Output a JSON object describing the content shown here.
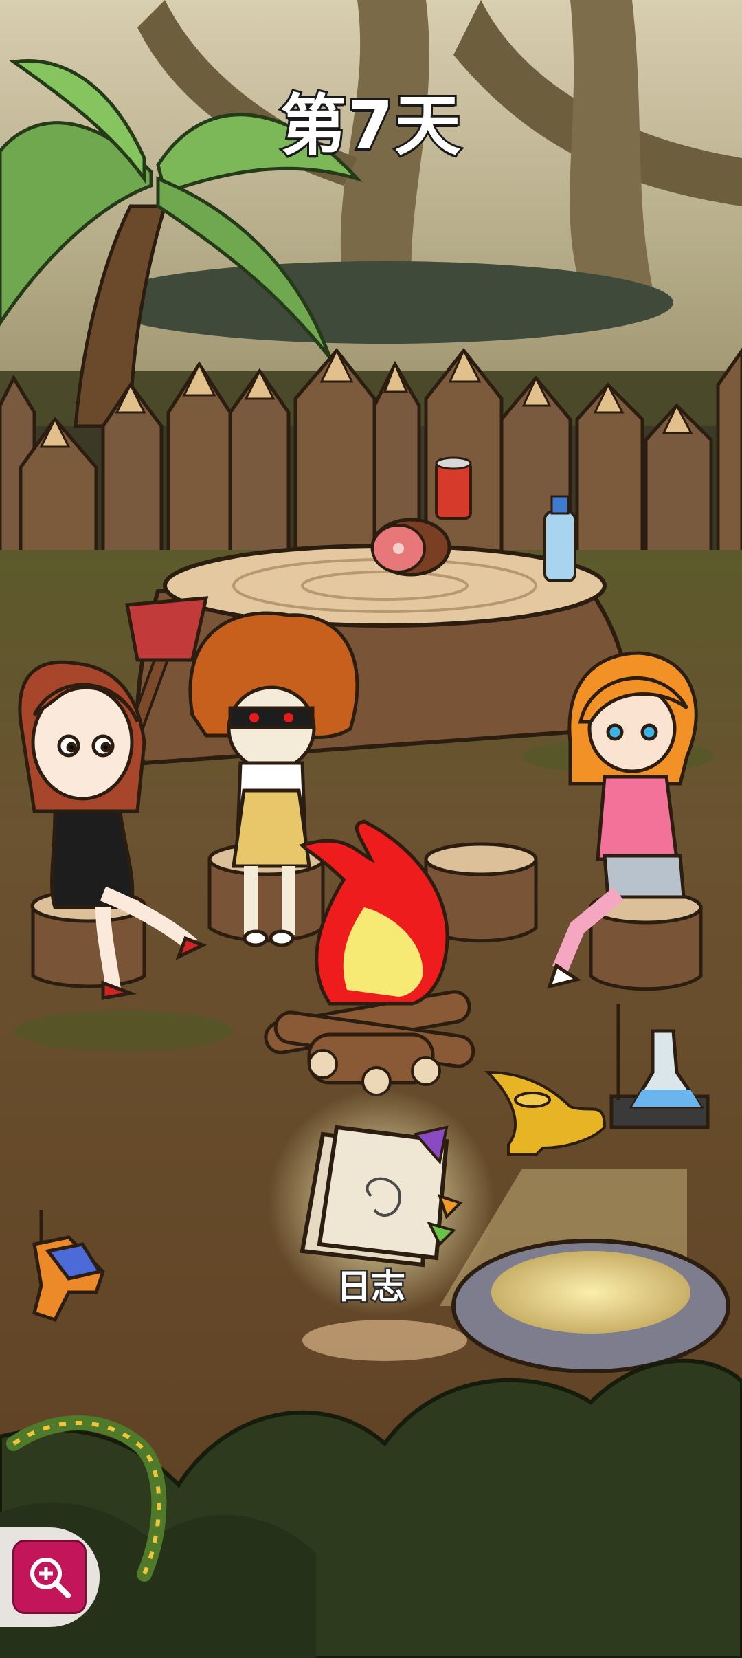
{
  "hud": {
    "day_title": "第7天",
    "zoom_button_icon": "zoom-in-icon"
  },
  "items": {
    "journal_label": "日志"
  },
  "colors": {
    "fire_outer": "#ee1c1c",
    "fire_inner": "#f6ea74",
    "zoom_button": "#c3155a",
    "ground": "#6e4e2e",
    "foliage": "#2e3a1e"
  }
}
